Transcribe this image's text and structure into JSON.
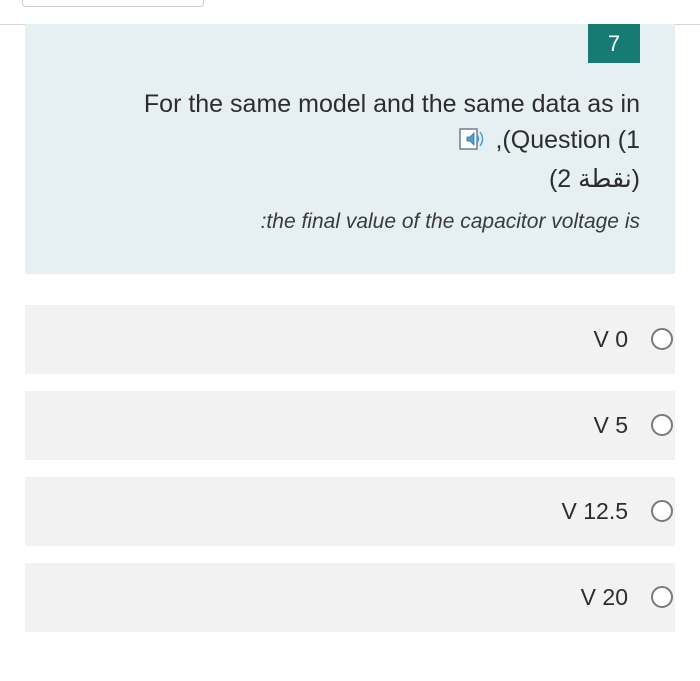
{
  "question": {
    "number": "7",
    "text_line1": "For the same model and the same data as in",
    "text_line2": ",(Question (1",
    "points": "(2 نقطة)",
    "prompt": ":the final value of the capacitor voltage is"
  },
  "icons": {
    "audio": "speaker-icon"
  },
  "options": [
    {
      "label": "V 0"
    },
    {
      "label": "V 5"
    },
    {
      "label": "V 12.5"
    },
    {
      "label": "V 20"
    }
  ],
  "colors": {
    "question_bg": "#e6eff1",
    "number_badge": "#167b73",
    "option_bg": "#f2f2f2"
  }
}
